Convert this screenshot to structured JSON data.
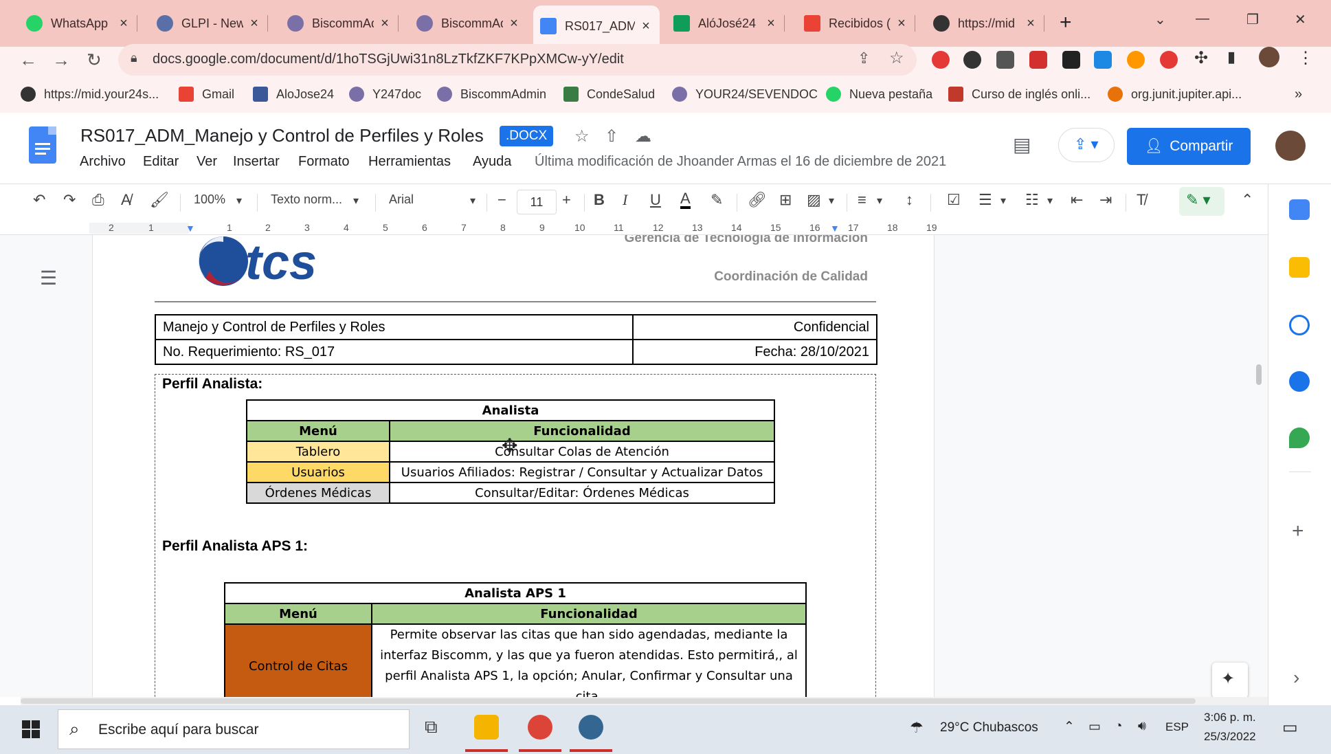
{
  "browser": {
    "tabs": [
      {
        "label": "WhatsApp",
        "icon": "whatsapp-icon",
        "color": "#25d366"
      },
      {
        "label": "GLPI - New",
        "icon": "glpi-icon",
        "color": "#5a6fa8"
      },
      {
        "label": "BiscommAd",
        "icon": "biscomm-icon",
        "color": "#7b6fa8"
      },
      {
        "label": "BiscommAd",
        "icon": "biscomm-icon",
        "color": "#7b6fa8"
      },
      {
        "label": "RS017_ADM",
        "icon": "google-docs-icon",
        "color": "#4285f4",
        "active": true
      },
      {
        "label": "AlóJosé24 (",
        "icon": "google-sheets-icon",
        "color": "#0f9d58"
      },
      {
        "label": "Recibidos (",
        "icon": "gmail-icon",
        "color": "#ea4335"
      },
      {
        "label": "https://mid",
        "icon": "globe-icon",
        "color": "#333333"
      }
    ],
    "new_tab": "+",
    "url": "docs.google.com/document/d/1hoTSGjUwi31n8LzTkfZKF7KPpXMCw-yY/edit",
    "bookmarks": [
      {
        "label": "https://mid.your24s...",
        "icon": "globe-icon",
        "color": "#333333"
      },
      {
        "label": "Gmail",
        "icon": "gmail-icon",
        "color": "#ea4335"
      },
      {
        "label": "AloJose24",
        "icon": "bookmark-icon",
        "color": "#3b5998"
      },
      {
        "label": "Y247doc",
        "icon": "bookmark-icon",
        "color": "#7b6fa8"
      },
      {
        "label": "BiscommAdmin",
        "icon": "bookmark-icon",
        "color": "#7b6fa8"
      },
      {
        "label": "CondeSalud",
        "icon": "bookmark-icon",
        "color": "#3a7d44"
      },
      {
        "label": "YOUR24/SEVENDOC",
        "icon": "bookmark-icon",
        "color": "#7b6fa8"
      },
      {
        "label": "Nueva pestaña",
        "icon": "whatsapp-icon",
        "color": "#25d366"
      },
      {
        "label": "Curso de inglés onli...",
        "icon": "bookmark-icon",
        "color": "#c0392b"
      },
      {
        "label": "org.junit.jupiter.api...",
        "icon": "bookmark-icon",
        "color": "#e8710a"
      }
    ],
    "more_bookmarks": "»"
  },
  "docs": {
    "title": "RS017_ADM_Manejo y Control de Perfiles y Roles",
    "badge": ".DOCX",
    "menu": [
      "Archivo",
      "Editar",
      "Ver",
      "Insertar",
      "Formato",
      "Herramientas",
      "Ayuda"
    ],
    "last_edit": "Última modificación de Jhoander Armas el 16 de diciembre de 2021",
    "share_label": "Compartir",
    "toolbar": {
      "zoom": "100%",
      "style": "Texto norm...",
      "font": "Arial",
      "font_size": "11"
    },
    "ruler_numbers": [
      "2",
      "1",
      "1",
      "2",
      "3",
      "4",
      "5",
      "6",
      "7",
      "8",
      "9",
      "10",
      "11",
      "12",
      "13",
      "14",
      "15",
      "16",
      "17",
      "18",
      "19"
    ]
  },
  "document": {
    "logo_text": "tcs",
    "header_line1": "Gerencia de Tecnología de Información",
    "header_line2": "Coordinación de Calidad",
    "meta": {
      "row1_left": "Manejo y Control de Perfiles y Roles",
      "row1_right": "Confidencial",
      "row2_left": "No. Requerimiento: RS_017",
      "row2_right": "Fecha: 28/10/2021"
    },
    "profile1": {
      "heading": "Perfil Analista:",
      "caption": "Analista",
      "col_menu": "Menú",
      "col_func": "Funcionalidad",
      "rows": [
        {
          "menu": "Tablero",
          "func": "Consultar Colas de Atención",
          "color": "#ffe699"
        },
        {
          "menu": "Usuarios",
          "func": "Usuarios Afiliados: Registrar / Consultar y Actualizar Datos",
          "color": "#ffd966"
        },
        {
          "menu": "Órdenes Médicas",
          "func": "Consultar/Editar: Órdenes Médicas",
          "color": "#d9d9d9"
        }
      ]
    },
    "profile2": {
      "heading": "Perfil Analista APS 1:",
      "caption": "Analista APS 1",
      "col_menu": "Menú",
      "col_func": "Funcionalidad",
      "rows": [
        {
          "menu": "Control de Citas",
          "color": "#c55a11",
          "func_lines": [
            "Permite observar las citas que han sido agendadas, mediante la",
            "interfaz Biscomm, y las que ya fueron atendidas. Esto permitirá,, al",
            "perfil Analista APS 1, la opción; Anular, Confirmar y Consultar una",
            "cita."
          ]
        }
      ]
    }
  },
  "taskbar": {
    "search_placeholder": "Escribe aquí para buscar",
    "weather": "29°C  Chubascos",
    "language": "ESP",
    "time": "3:06 p. m.",
    "date": "25/3/2022"
  }
}
